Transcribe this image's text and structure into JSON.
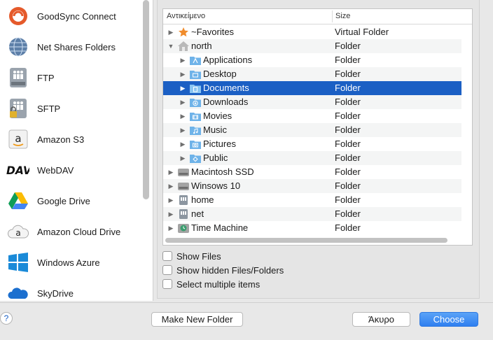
{
  "sidebar": {
    "items": [
      {
        "label": "GoodSync Connect",
        "icon": "goodsync-connect-icon"
      },
      {
        "label": "Net Shares Folders",
        "icon": "network-globe-icon"
      },
      {
        "label": "FTP",
        "icon": "ftp-server-icon"
      },
      {
        "label": "SFTP",
        "icon": "sftp-server-lock-icon"
      },
      {
        "label": "Amazon S3",
        "icon": "amazon-s3-icon"
      },
      {
        "label": "WebDAV",
        "icon": "webdav-icon"
      },
      {
        "label": "Google Drive",
        "icon": "google-drive-icon"
      },
      {
        "label": "Amazon Cloud Drive",
        "icon": "amazon-cloud-drive-icon"
      },
      {
        "label": "Windows Azure",
        "icon": "windows-azure-icon"
      },
      {
        "label": "SkyDrive",
        "icon": "skydrive-icon"
      }
    ]
  },
  "tree": {
    "columns": {
      "name": "Αντικείμενο",
      "size": "Size"
    },
    "rows": [
      {
        "name": "~Favorites",
        "size": "Virtual Folder",
        "icon": "star-icon"
      },
      {
        "name": "north",
        "size": "Folder",
        "icon": "home-icon"
      },
      {
        "name": "Applications",
        "size": "Folder",
        "icon": "applications-folder-icon"
      },
      {
        "name": "Desktop",
        "size": "Folder",
        "icon": "desktop-folder-icon"
      },
      {
        "name": "Documents",
        "size": "Folder",
        "icon": "documents-folder-icon"
      },
      {
        "name": "Downloads",
        "size": "Folder",
        "icon": "downloads-folder-icon"
      },
      {
        "name": "Movies",
        "size": "Folder",
        "icon": "movies-folder-icon"
      },
      {
        "name": "Music",
        "size": "Folder",
        "icon": "music-folder-icon"
      },
      {
        "name": "Pictures",
        "size": "Folder",
        "icon": "pictures-folder-icon"
      },
      {
        "name": "Public",
        "size": "Folder",
        "icon": "public-folder-icon"
      },
      {
        "name": "Macintosh SSD",
        "size": "Folder",
        "icon": "hard-drive-icon"
      },
      {
        "name": "Winsows 10",
        "size": "Folder",
        "icon": "hard-drive-icon"
      },
      {
        "name": "home",
        "size": "Folder",
        "icon": "network-drive-icon"
      },
      {
        "name": "net",
        "size": "Folder",
        "icon": "network-drive-icon"
      },
      {
        "name": "Time Machine",
        "size": "Folder",
        "icon": "time-machine-drive-icon"
      }
    ]
  },
  "options": {
    "show_files": "Show Files",
    "show_hidden": "Show hidden Files/Folders",
    "select_multiple": "Select multiple items"
  },
  "buttons": {
    "help": "?",
    "make_new_folder": "Make New Folder",
    "cancel": "Άκυρο",
    "choose": "Choose"
  },
  "colors": {
    "selection": "#1b5fc4",
    "folder_blue": "#6fb3e9",
    "choose_button": "#2f7ff0"
  }
}
